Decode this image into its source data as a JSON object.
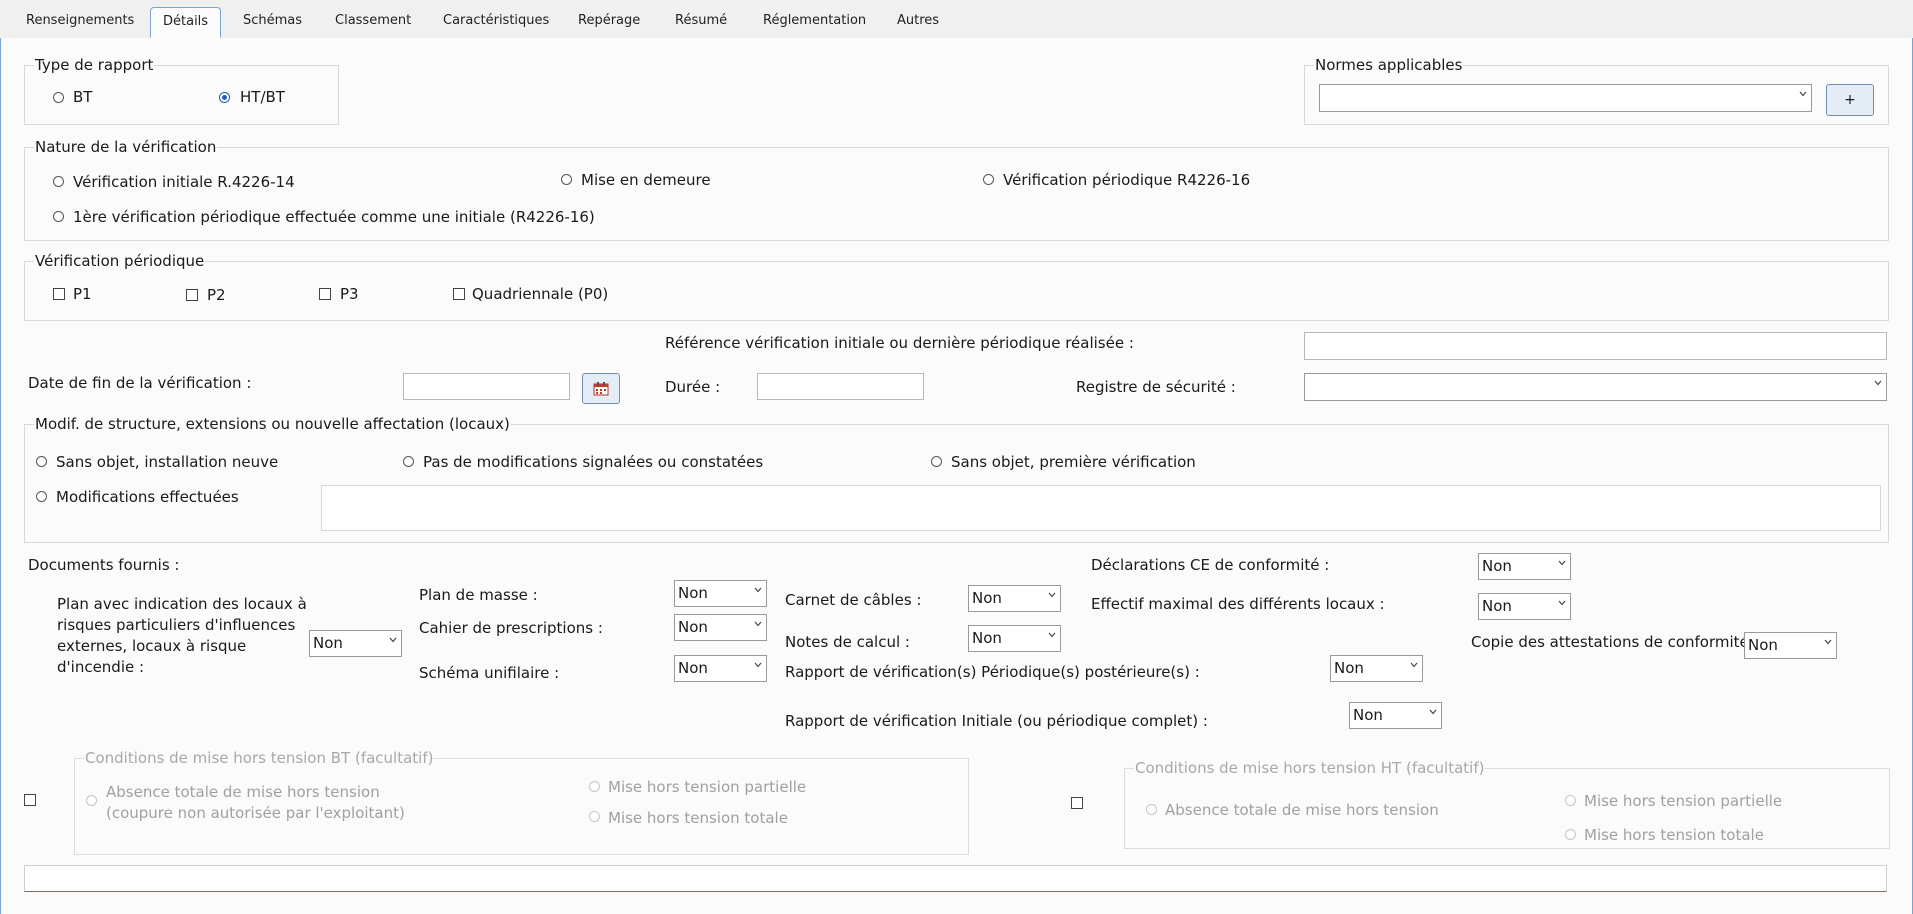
{
  "tabs": [
    {
      "label": "Renseignements"
    },
    {
      "label": "Détails"
    },
    {
      "label": "Schémas"
    },
    {
      "label": "Classement"
    },
    {
      "label": "Caractéristiques"
    },
    {
      "label": "Repérage"
    },
    {
      "label": "Résumé"
    },
    {
      "label": "Réglementation"
    },
    {
      "label": "Autres"
    }
  ],
  "type_rapport": {
    "title": "Type de rapport",
    "options": [
      "BT",
      "HT/BT"
    ],
    "selected": "HT/BT"
  },
  "normes": {
    "title": "Normes applicables",
    "value": "",
    "add_label": "+"
  },
  "nature": {
    "title": "Nature de la vérification",
    "options": [
      "Vérification initiale R.4226-14",
      "Mise en demeure",
      "Vérification périodique R4226-16",
      "1ère vérification périodique effectuée comme une initiale (R4226-16)"
    ]
  },
  "periodique": {
    "title": "Vérification périodique",
    "options": [
      "P1",
      "P2",
      "P3",
      "Quadriennale (P0)"
    ]
  },
  "reference": {
    "label": "Référence vérification initiale ou dernière périodique réalisée :",
    "value": ""
  },
  "date_fin": {
    "label": "Date de fin de la vérification :",
    "value": ""
  },
  "duree": {
    "label": "Durée :",
    "value": ""
  },
  "registre": {
    "label": "Registre de sécurité :",
    "value": ""
  },
  "modif": {
    "title": "Modif. de structure, extensions ou nouvelle affectation (locaux)",
    "options": [
      "Sans objet, installation neuve",
      "Pas de modifications signalées ou constatées",
      "Sans objet, première vérification",
      "Modifications effectuées"
    ],
    "text": ""
  },
  "documents": {
    "title": "Documents fournis :",
    "plan_locaux": {
      "label_lines": [
        "Plan avec indication des locaux à",
        "risques particuliers d'influences",
        "externes, locaux à risque",
        "d'incendie :"
      ],
      "value": "Non"
    },
    "plan_masse": {
      "label": "Plan de masse :",
      "value": "Non"
    },
    "cahier": {
      "label": "Cahier de prescriptions :",
      "value": "Non"
    },
    "schema": {
      "label": "Schéma unifilaire :",
      "value": "Non"
    },
    "carnet": {
      "label": "Carnet de câbles :",
      "value": "Non"
    },
    "notes": {
      "label": "Notes de calcul :",
      "value": "Non"
    },
    "rapport_post": {
      "label": "Rapport de vérification(s) Périodique(s) postérieure(s) :",
      "value": "Non"
    },
    "rapport_init": {
      "label": "Rapport de vérification Initiale (ou périodique complet) :",
      "value": "Non"
    },
    "declarations": {
      "label": "Déclarations CE de conformité :",
      "value": "Non"
    },
    "effectif": {
      "label": "Effectif maximal des différents locaux :",
      "value": "Non"
    },
    "copie": {
      "label": "Copie des attestations de conformité :",
      "value": "Non"
    }
  },
  "mht_bt": {
    "title": "Conditions de mise hors tension BT (facultatif)",
    "absence_lines": [
      "Absence totale de mise hors tension",
      "(coupure non autorisée par l'exploitant)"
    ],
    "partielle": "Mise hors tension partielle",
    "totale": "Mise hors tension totale"
  },
  "mht_ht": {
    "title": "Conditions de mise hors tension HT (facultatif)",
    "absence": "Absence totale de mise hors tension",
    "partielle": "Mise hors tension partielle",
    "totale": "Mise hors tension totale"
  },
  "footer_text": ""
}
